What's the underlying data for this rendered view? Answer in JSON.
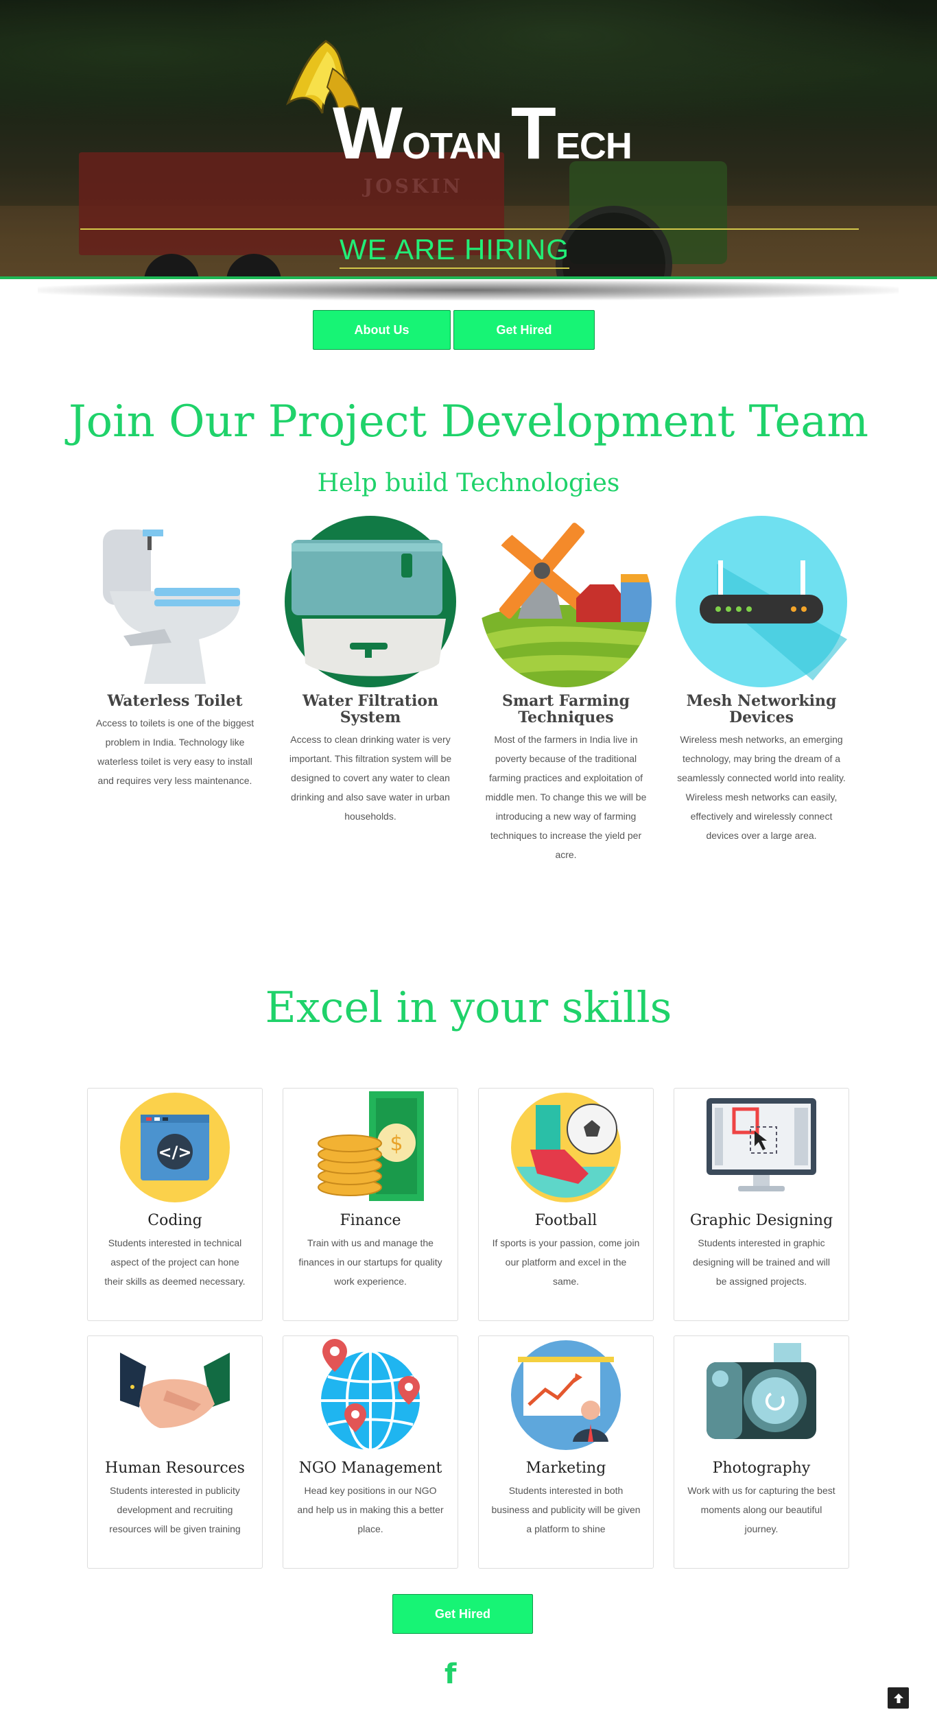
{
  "brand": {
    "name_part1": "W",
    "name_part2": "OTAN ",
    "name_part3": "T",
    "name_part4": "ECH",
    "trailer_text": "JOSKIN"
  },
  "hero": {
    "headline": "WE ARE HIRING"
  },
  "nav": {
    "about_label": "About Us",
    "hire_label": "Get Hired"
  },
  "projects": {
    "title": "Join Our Project Development Team",
    "subtitle": "Help build Technologies",
    "items": [
      {
        "title": "Waterless Toilet",
        "icon": "toilet-icon",
        "text": "Access to toilets is one of the biggest problem in India. Technology like waterless toilet is very easy to install and requires very less maintenance."
      },
      {
        "title": "Water Filtration System",
        "icon": "water-filter-icon",
        "text": "Access to clean drinking water is very important. This filtration system will be designed to covert any water to clean drinking and also save water in urban households."
      },
      {
        "title": "Smart Farming Techniques",
        "icon": "windmill-farm-icon",
        "text": "Most of the farmers in India live in poverty because of the traditional farming practices and exploitation of middle men. To change this we will be introducing a new way of farming techniques to increase the yield per acre."
      },
      {
        "title": "Mesh Networking Devices",
        "icon": "router-icon",
        "text": "Wireless mesh networks, an emerging technology, may bring the dream of a seamlessly connected world into reality. Wireless mesh networks can easily, effectively and wirelessly connect devices over a large area."
      }
    ]
  },
  "skills": {
    "title": "Excel in your skills",
    "items": [
      {
        "title": "Coding",
        "icon": "code-window-icon",
        "text": "Students interested in technical aspect of the project can hone their skills as deemed necessary."
      },
      {
        "title": "Finance",
        "icon": "coins-money-icon",
        "text": "Train with us and manage the finances in our startups for quality work experience."
      },
      {
        "title": "Football",
        "icon": "football-icon",
        "text": "If sports is your passion, come join our platform and excel in the same."
      },
      {
        "title": "Graphic Designing",
        "icon": "design-monitor-icon",
        "text": "Students interested in graphic designing will be trained and will be assigned projects."
      },
      {
        "title": "Human Resources",
        "icon": "handshake-icon",
        "text": "Students interested in publicity development and recruiting resources will be given training"
      },
      {
        "title": "NGO Management",
        "icon": "globe-pins-icon",
        "text": "Head key positions in our NGO and help us in making this a better place."
      },
      {
        "title": "Marketing",
        "icon": "presentation-chart-icon",
        "text": "Students interested in both business and publicity will be given a platform to shine"
      },
      {
        "title": "Photography",
        "icon": "camera-icon",
        "text": "Work with us for capturing the best moments along our beautiful journey."
      }
    ]
  },
  "cta": {
    "label": "Get Hired"
  },
  "footer": {
    "facebook_glyph": "f",
    "to_top_glyph": "🡅"
  },
  "colors": {
    "accent": "#1fd26a",
    "button": "#17f475",
    "hero_bar": "#1eb855"
  }
}
